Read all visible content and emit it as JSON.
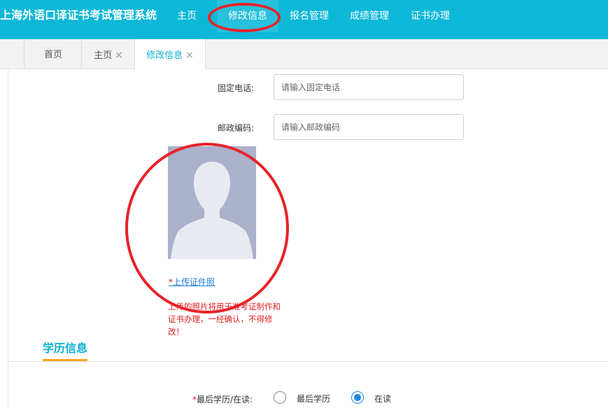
{
  "app": {
    "title": "上海外语口译证书考试管理系统"
  },
  "nav": {
    "items": [
      "主页",
      "修改信息",
      "报名管理",
      "成绩管理",
      "证书办理"
    ],
    "active": 1
  },
  "tabs": {
    "items": [
      {
        "label": "首页"
      },
      {
        "label": "主页"
      },
      {
        "label": "修改信息"
      }
    ],
    "close_icon": "×",
    "active": 2
  },
  "form": {
    "phone": {
      "label": "固定电话:",
      "placeholder": "请输入固定电话"
    },
    "postcode": {
      "label": "邮政编码:",
      "placeholder": "请输入邮政编码"
    },
    "photo": {
      "upload_star": "*",
      "upload_label": "上传证件照",
      "note": "上传的照片将用于准考证制作和证书办理，一经确认，不得修改！"
    }
  },
  "education": {
    "section_title": "学历信息",
    "status": {
      "required": "*",
      "label": "最后学历/在读:",
      "options": [
        "最后学历",
        "在读"
      ],
      "selected": "在读"
    }
  },
  "colors": {
    "accent": "#0bb8d8",
    "annotation": "#e8222a",
    "warning": "#e02020",
    "underline": "#f5a623"
  }
}
